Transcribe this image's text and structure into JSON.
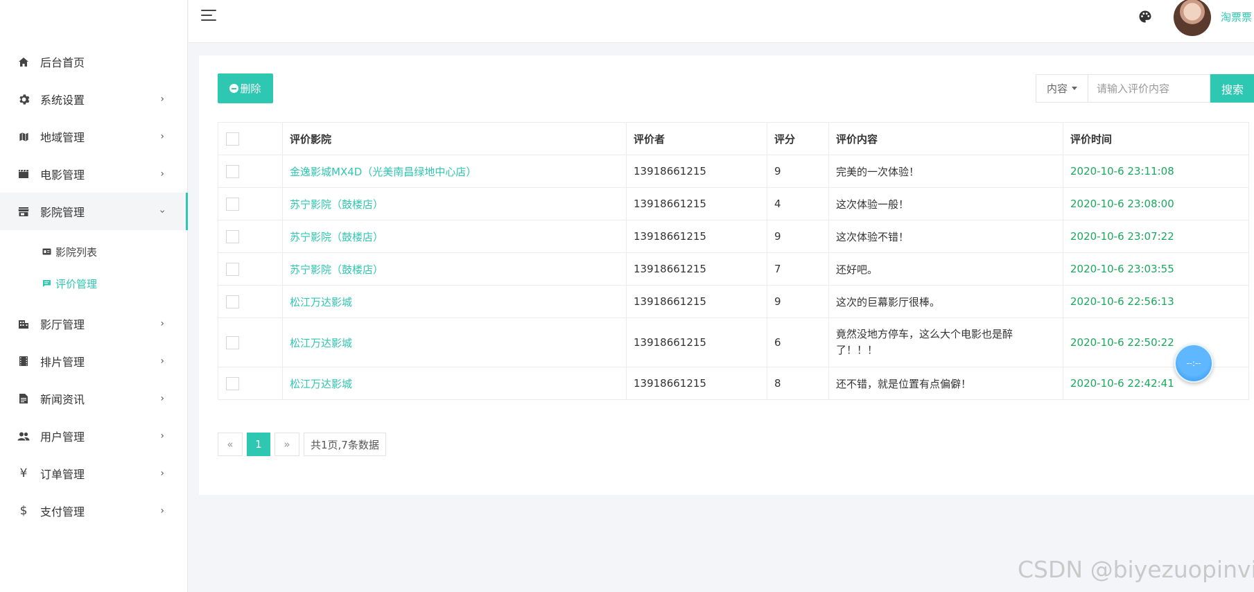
{
  "sidebar": {
    "items": [
      {
        "label": "后台首页",
        "icon": "home-icon"
      },
      {
        "label": "系统设置",
        "icon": "gear-icon"
      },
      {
        "label": "地域管理",
        "icon": "map-icon"
      },
      {
        "label": "电影管理",
        "icon": "clapper-icon"
      },
      {
        "label": "影院管理",
        "icon": "store-icon"
      },
      {
        "label": "影厅管理",
        "icon": "building-icon"
      },
      {
        "label": "排片管理",
        "icon": "film-icon"
      },
      {
        "label": "新闻资讯",
        "icon": "news-icon"
      },
      {
        "label": "用户管理",
        "icon": "users-icon"
      },
      {
        "label": "订单管理",
        "icon": "yen-icon"
      },
      {
        "label": "支付管理",
        "icon": "dollar-icon"
      }
    ],
    "sub_items": [
      {
        "label": "影院列表",
        "icon": "ticket-icon"
      },
      {
        "label": "评价管理",
        "icon": "comment-icon"
      }
    ],
    "yen_glyph": "¥",
    "dollar_glyph": "$"
  },
  "header": {
    "username": "淘票票"
  },
  "toolbar": {
    "delete_label": "删除",
    "search_field": "内容",
    "search_placeholder": "请输入评价内容",
    "search_button": "搜索"
  },
  "table": {
    "headers": [
      "评价影院",
      "评价者",
      "评分",
      "评价内容",
      "评价时间"
    ],
    "rows": [
      {
        "cinema": "金逸影城MX4D（光美南昌绿地中心店）",
        "user": "13918661215",
        "score": "9",
        "content": "完美的一次体验！",
        "time": "2020-10-6 23:11:08"
      },
      {
        "cinema": "苏宁影院（鼓楼店）",
        "user": "13918661215",
        "score": "4",
        "content": "这次体验一般！",
        "time": "2020-10-6 23:08:00"
      },
      {
        "cinema": "苏宁影院（鼓楼店）",
        "user": "13918661215",
        "score": "9",
        "content": "这次体验不错！",
        "time": "2020-10-6 23:07:22"
      },
      {
        "cinema": "苏宁影院（鼓楼店）",
        "user": "13918661215",
        "score": "7",
        "content": "还好吧。",
        "time": "2020-10-6 23:03:55"
      },
      {
        "cinema": "松江万达影城",
        "user": "13918661215",
        "score": "9",
        "content": "这次的巨幕影厅很棒。",
        "time": "2020-10-6 22:56:13"
      },
      {
        "cinema": "松江万达影城",
        "user": "13918661215",
        "score": "6",
        "content": "竟然没地方停车，这么大个电影也是醉了！！！",
        "time": "2020-10-6 22:50:22"
      },
      {
        "cinema": "松江万达影城",
        "user": "13918661215",
        "score": "8",
        "content": "还不错，就是位置有点偏僻！",
        "time": "2020-10-6 22:42:41"
      }
    ]
  },
  "pager": {
    "prev": "«",
    "current": "1",
    "next": "»",
    "info": "共1页,7条数据"
  },
  "float_widget": {
    "text": "--:--"
  },
  "watermark": "CSDN @biyezuopinvip",
  "colors": {
    "accent": "#2ec7b1",
    "time_green": "#1aa85c"
  }
}
